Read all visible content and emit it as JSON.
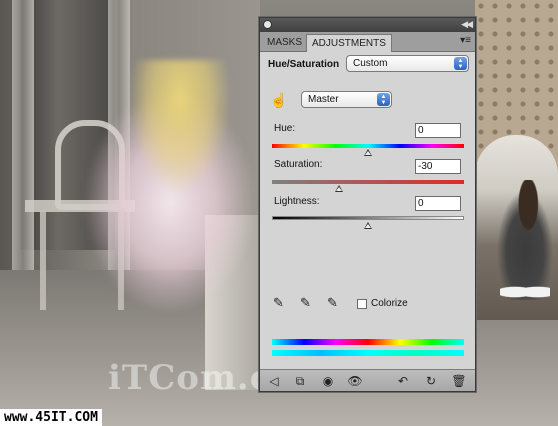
{
  "panel": {
    "tabs": [
      {
        "label": "MASKS",
        "active": false
      },
      {
        "label": "ADJUSTMENTS",
        "active": true
      }
    ],
    "adjustment_title": "Hue/Saturation",
    "preset": {
      "selected": "Custom"
    },
    "channel": {
      "selected": "Master"
    },
    "hue": {
      "label": "Hue:",
      "value": "0"
    },
    "saturation": {
      "label": "Saturation:",
      "value": "-30"
    },
    "lightness": {
      "label": "Lightness:",
      "value": "0"
    },
    "colorize": {
      "label": "Colorize",
      "checked": false
    },
    "bottom_icons": [
      "back-arrow-icon",
      "expand-view-icon",
      "clip-layer-icon",
      "visibility-eye-icon",
      "view-previous-icon",
      "reset-icon",
      "trash-icon"
    ],
    "accent_color": "#2b63c2"
  },
  "image": {
    "watermark": "iTCom.cn",
    "site_tag": "www.45IT.COM"
  }
}
